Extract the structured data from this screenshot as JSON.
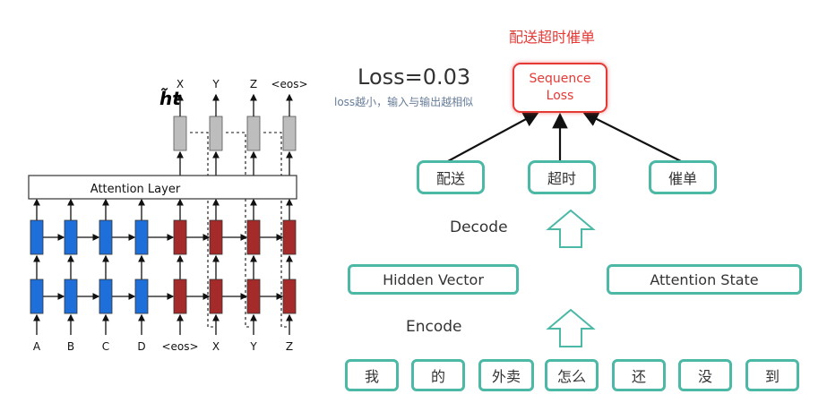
{
  "seq2seq_figure": {
    "ht_label": "h̃t",
    "outputs": [
      "X",
      "Y",
      "Z",
      "<eos>"
    ],
    "attention_layer": "Attention Layer",
    "inputs": [
      "A",
      "B",
      "C",
      "D",
      "<eos>",
      "X",
      "Y",
      "Z"
    ],
    "colors": {
      "encoder": "#1e6fd9",
      "decoder": "#a52a2a",
      "output": "#bdbdbd"
    }
  },
  "flow": {
    "top_title": "配送超时催单",
    "loss_value": "Loss=0.03",
    "loss_note": "loss越小，输入与输出越相似",
    "sequence_loss": [
      "Sequence",
      "Loss"
    ],
    "decoded_tokens": [
      "配送",
      "超时",
      "催单"
    ],
    "decode_label": "Decode",
    "encode_label": "Encode",
    "hidden_vector": "Hidden Vector",
    "attention_state": "Attention State",
    "input_tokens": [
      "我",
      "的",
      "外卖",
      "怎么",
      "还",
      "没",
      "到"
    ],
    "colors": {
      "box_border": "#4cb8a6",
      "accent_red": "#e53935"
    }
  }
}
